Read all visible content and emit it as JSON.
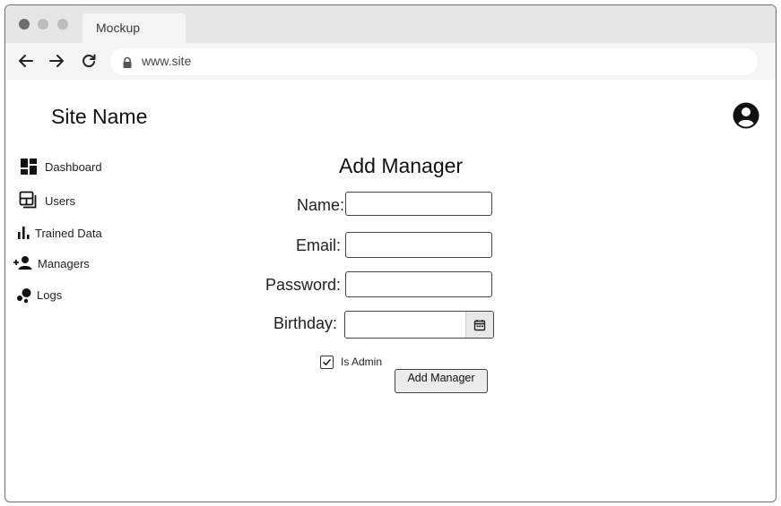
{
  "browser": {
    "tab_title": "Mockup",
    "url": "www.site"
  },
  "header": {
    "site_name": "Site Name"
  },
  "sidebar": {
    "items": [
      {
        "label": "Dashboard",
        "icon": "dashboard-icon"
      },
      {
        "label": "Users",
        "icon": "users-icon"
      },
      {
        "label": "Trained Data",
        "icon": "bar-chart-icon"
      },
      {
        "label": "Managers",
        "icon": "add-person-icon"
      },
      {
        "label": "Logs",
        "icon": "bubbles-icon"
      }
    ]
  },
  "form": {
    "title": "Add Manager",
    "fields": {
      "name_label": "Name:",
      "email_label": "Email:",
      "password_label": "Password:",
      "birthday_label": "Birthday:"
    },
    "is_admin_label": "Is Admin",
    "is_admin_checked": true,
    "submit_label": "Add Manager"
  }
}
